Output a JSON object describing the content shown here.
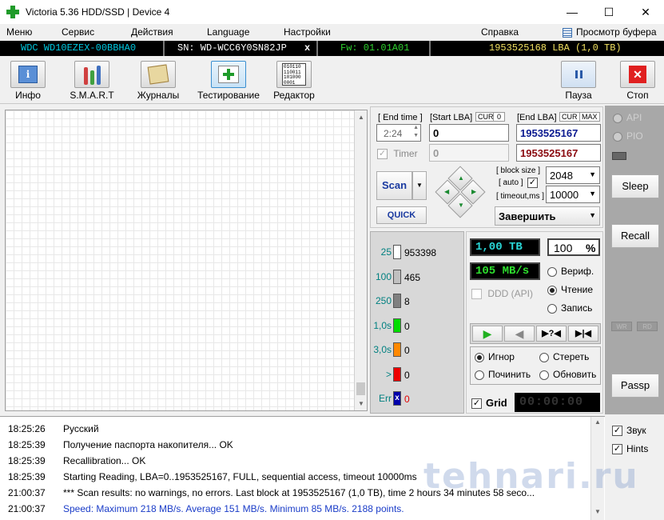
{
  "window": {
    "title": "Victoria 5.36 HDD/SSD | Device 4",
    "minimize": "—",
    "maximize": "☐",
    "close": "✕"
  },
  "menu": {
    "items": [
      "Меню",
      "Сервис",
      "Действия",
      "Language",
      "Настройки"
    ],
    "help": "Справка",
    "buffer_view": "Просмотр буфера"
  },
  "info": {
    "model": "WDC WD10EZEX-00BBHA0",
    "serial": "SN: WD-WCC6Y0SN82JP",
    "x": "x",
    "firmware": "Fw: 01.01A01",
    "lba": "1953525168 LBA (1,0 TB)"
  },
  "toolbar": {
    "info": "Инфо",
    "smart": "S.M.A.R.T",
    "logs": "Журналы",
    "test": "Тестирование",
    "editor": "Редактор",
    "pause": "Пауза",
    "stop": "Стоп",
    "editor_icon_text": "010110\n110011\n101000\n0001"
  },
  "scan": {
    "end_time_label": "[ End time ]",
    "end_time": "2:24",
    "timer_label": "Timer",
    "timer_value": "0",
    "start_lba_label": "[Start LBA]",
    "cur_label": "CUR",
    "cur_value": "0",
    "start_lba": "0",
    "end_lba_label": "[End LBA]",
    "end_cur_label": "CUR",
    "max_label": "MAX",
    "end_lba": "1953525167",
    "end_lba_2": "1953525167",
    "scan_button": "Scan",
    "quick_button": "QUICK",
    "block_size_label": "[ block size ]",
    "auto_label": "[ auto ]",
    "timeout_label": "[ timeout,ms ]",
    "block_size": "2048",
    "timeout": "10000",
    "finish_select": "Завершить"
  },
  "stats": [
    {
      "label": "25",
      "value": "953398",
      "color": "#ffffff",
      "label_color": "#008080"
    },
    {
      "label": "100",
      "value": "465",
      "color": "#c0c0c0",
      "label_color": "#008080"
    },
    {
      "label": "250",
      "value": "8",
      "color": "#808080",
      "label_color": "#008080"
    },
    {
      "label": "1,0s",
      "value": "0",
      "color": "#00dd00",
      "label_color": "#008080"
    },
    {
      "label": "3,0s",
      "value": "0",
      "color": "#ff8800",
      "label_color": "#008080"
    },
    {
      "label": ">",
      "value": "0",
      "color": "#ee0000",
      "label_color": "#008080"
    },
    {
      "label": "Err",
      "value": "0",
      "color": "#0000aa",
      "label_color": "#008080",
      "mark": "x"
    }
  ],
  "progress": {
    "size": "1,00 TB",
    "percent": "100",
    "percent_sign": "%",
    "speed": "105 MB/s",
    "ddd_api": "DDD (API)",
    "verify": "Вериф.",
    "read": "Чтение",
    "write": "Запись",
    "ignore": "Игнор",
    "erase": "Стереть",
    "repair": "Починить",
    "refresh": "Обновить",
    "grid": "Grid",
    "timer": "00:00:00"
  },
  "rightbar": {
    "api": "API",
    "pio": "PIO",
    "sleep": "Sleep",
    "recall": "Recall",
    "wr": "WR",
    "rd": "RD",
    "passp": "Passp"
  },
  "log": [
    {
      "time": "18:25:26",
      "text": "Русский",
      "color": "#000000"
    },
    {
      "time": "18:25:39",
      "text": "Получение паспорта накопителя... OK",
      "color": "#000000"
    },
    {
      "time": "18:25:39",
      "text": "Recallibration... OK",
      "color": "#000000"
    },
    {
      "time": "18:25:39",
      "text": "Starting Reading, LBA=0..1953525167, FULL, sequential access, timeout 10000ms",
      "color": "#000000"
    },
    {
      "time": "21:00:37",
      "text": "*** Scan results: no warnings, no errors. Last block at 1953525167 (1,0 TB), time 2 hours 34 minutes 58 seco...",
      "color": "#000000"
    },
    {
      "time": "21:00:37",
      "text": "Speed: Maximum 218 MB/s. Average 151 MB/s. Minimum 85 MB/s. 2188 points.",
      "color": "#1a3cc8"
    }
  ],
  "logside": {
    "sound": "Звук",
    "hints": "Hints"
  },
  "watermark": "tehnari.ru"
}
